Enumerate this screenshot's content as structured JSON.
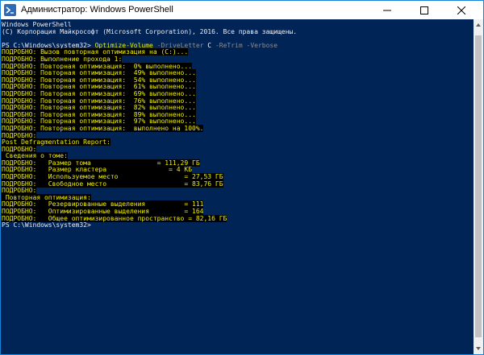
{
  "window": {
    "title": "Администратор: Windows PowerShell",
    "accent": "#1883d7",
    "console_bg": "#012456",
    "highlight_fg": "#f0f000",
    "highlight_bg": "#000000"
  },
  "buttons": {
    "minimize_icon": "minimize-icon",
    "maximize_icon": "maximize-icon",
    "close_icon": "close-icon"
  },
  "console": {
    "header_1": "Windows PowerShell",
    "header_2": "(C) Корпорация Майкрософт (Microsoft Corporation), 2016. Все права защищены.",
    "prompt": "PS C:\\Windows\\system32> ",
    "command": {
      "cmdlet": "Optimize-Volume",
      "param1": "-DriveLetter",
      "value1": "C",
      "param2": "-ReTrim",
      "param3": "-Verbose"
    },
    "output": [
      "ПОДРОБНО: Вызов повторная оптимизация на (C:)...",
      "ПОДРОБНО: Выполнение прохода 1:",
      "ПОДРОБНО: Повторная оптимизация:  0% выполнено...",
      "ПОДРОБНО: Повторная оптимизация:  49% выполнено...",
      "ПОДРОБНО: Повторная оптимизация:  54% выполнено...",
      "ПОДРОБНО: Повторная оптимизация:  61% выполнено...",
      "ПОДРОБНО: Повторная оптимизация:  69% выполнено...",
      "ПОДРОБНО: Повторная оптимизация:  76% выполнено...",
      "ПОДРОБНО: Повторная оптимизация:  82% выполнено...",
      "ПОДРОБНО: Повторная оптимизация:  89% выполнено...",
      "ПОДРОБНО: Повторная оптимизация:  97% выполнено...",
      "ПОДРОБНО: Повторная оптимизация:  выполнено на 100%.",
      "ПОДРОБНО:",
      "Post Defragmentation Report:",
      "ПОДРОБНО:",
      " Сведения о томе:",
      "ПОДРОБНО:   Размер тома                 = 111,29 ГБ",
      "ПОДРОБНО:   Размер кластера                = 4 КБ",
      "ПОДРОБНО:   Используемое место                 = 27,53 ГБ",
      "ПОДРОБНО:   Свободное место                    = 83,76 ГБ",
      "ПОДРОБНО:",
      " Повторная оптимизация:",
      "ПОДРОБНО:   Резервированные выделения          = 111",
      "ПОДРОБНО:   Оптимизированные выделения         = 164",
      "ПОДРОБНО:   Общее оптимизированное пространство = 82,16 ГБ"
    ],
    "final_prompt": "PS C:\\Windows\\system32>"
  }
}
